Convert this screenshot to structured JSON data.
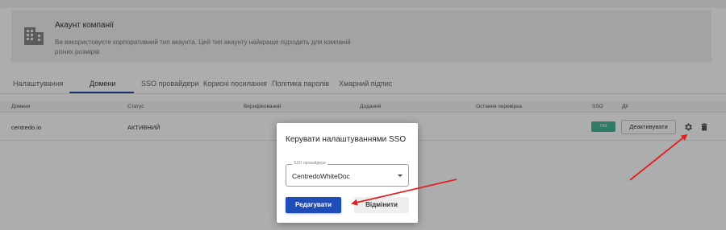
{
  "account": {
    "title": "Акаунт компанії",
    "description": "Ви використовуєте корпоративний тип акаунта. Цей тип акаунту найкраще підходить для компаній різних розмірів",
    "icon": "building-icon"
  },
  "tabs": [
    {
      "label": "Налаштування",
      "active": false
    },
    {
      "label": "Домени",
      "active": true
    },
    {
      "label": "SSO провайдери",
      "active": false
    },
    {
      "label": "Корисні посилання",
      "active": false
    },
    {
      "label": "Політика паролів",
      "active": false
    },
    {
      "label": "Хмарний підпис",
      "active": false
    }
  ],
  "table": {
    "columns": [
      "Домени",
      "Статус",
      "Верифікований",
      "Доданий",
      "Остання перевірка",
      "SSO",
      "Дії"
    ],
    "rows": [
      {
        "domain": "centredo.io",
        "status": "АКТИВНИЙ",
        "sso": "ТАК",
        "deactivate_label": "Деактивувати"
      }
    ]
  },
  "modal": {
    "title": "Керувати налаштуваннями SSO",
    "select_label": "SSO провайдери",
    "select_value": "CentredoWhiteDoc",
    "edit_label": "Редагувати",
    "cancel_label": "Відмінити"
  },
  "colors": {
    "primary": "#1f4db8",
    "sso_badge": "#46b59a",
    "annotation_arrow": "#e02020",
    "tab_underline": "#2b4aa6"
  }
}
